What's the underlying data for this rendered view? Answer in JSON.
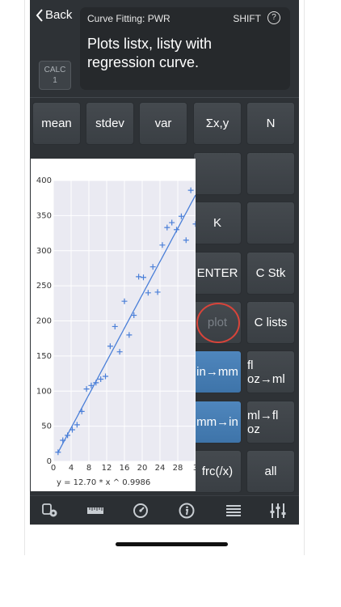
{
  "header": {
    "back_label": "Back",
    "calc_badge": {
      "line1": "CALC",
      "line2": "1"
    }
  },
  "display": {
    "mode": "Curve Fitting: PWR",
    "shift": "SHIFT",
    "help": "?",
    "text": "Plots listx, listy with regression curve."
  },
  "keys": {
    "row1": [
      "mean",
      "stdev",
      "var",
      "Σx,y",
      "N"
    ],
    "k": "K",
    "enter": "ENTER",
    "c_stk": "C Stk",
    "plot": "plot",
    "c_lists": "C lists",
    "in_mm": "in→mm",
    "floz_ml": "fl oz→ml",
    "mm_in": "mm→in",
    "ml_floz": "ml→fl oz",
    "frc": "frc(/x)",
    "all": "all"
  },
  "chart_data": {
    "type": "scatter",
    "title": "",
    "xlabel": "",
    "ylabel": "",
    "xlim": [
      0,
      30
    ],
    "ylim": [
      0,
      400
    ],
    "x_ticks": [
      "0",
      "4",
      "8",
      "12",
      "16",
      "20",
      "24",
      "28",
      "3"
    ],
    "y_ticks": [
      "0",
      "50",
      "100",
      "150",
      "200",
      "250",
      "300",
      "350",
      "400"
    ],
    "annotation": "y = 12.70 * x ^ 0.9986",
    "points": [
      {
        "x": 1,
        "y": 13
      },
      {
        "x": 2,
        "y": 30
      },
      {
        "x": 3,
        "y": 37
      },
      {
        "x": 4,
        "y": 45
      },
      {
        "x": 5,
        "y": 52
      },
      {
        "x": 6,
        "y": 71
      },
      {
        "x": 7,
        "y": 103
      },
      {
        "x": 8,
        "y": 108
      },
      {
        "x": 9,
        "y": 112
      },
      {
        "x": 10,
        "y": 117
      },
      {
        "x": 11,
        "y": 121
      },
      {
        "x": 12,
        "y": 164
      },
      {
        "x": 13,
        "y": 192
      },
      {
        "x": 14,
        "y": 156
      },
      {
        "x": 15,
        "y": 228
      },
      {
        "x": 16,
        "y": 180
      },
      {
        "x": 17,
        "y": 208
      },
      {
        "x": 18,
        "y": 263
      },
      {
        "x": 19,
        "y": 262
      },
      {
        "x": 20,
        "y": 240
      },
      {
        "x": 21,
        "y": 277
      },
      {
        "x": 22,
        "y": 241
      },
      {
        "x": 23,
        "y": 308
      },
      {
        "x": 24,
        "y": 333
      },
      {
        "x": 25,
        "y": 340
      },
      {
        "x": 26,
        "y": 330
      },
      {
        "x": 27,
        "y": 349
      },
      {
        "x": 28,
        "y": 315
      },
      {
        "x": 29,
        "y": 386
      },
      {
        "x": 30,
        "y": 338
      }
    ],
    "fit": {
      "a": 12.7,
      "b": 0.9986
    },
    "point_color": "#4a7fd8",
    "line_color": "#4a7fd8",
    "plot_bg": "#eaeaf2",
    "grid": true
  },
  "toolbar": {
    "icons": [
      "settings-cog-icon",
      "ruler-icon",
      "gauge-icon",
      "info-icon",
      "list-icon",
      "sliders-icon"
    ]
  }
}
